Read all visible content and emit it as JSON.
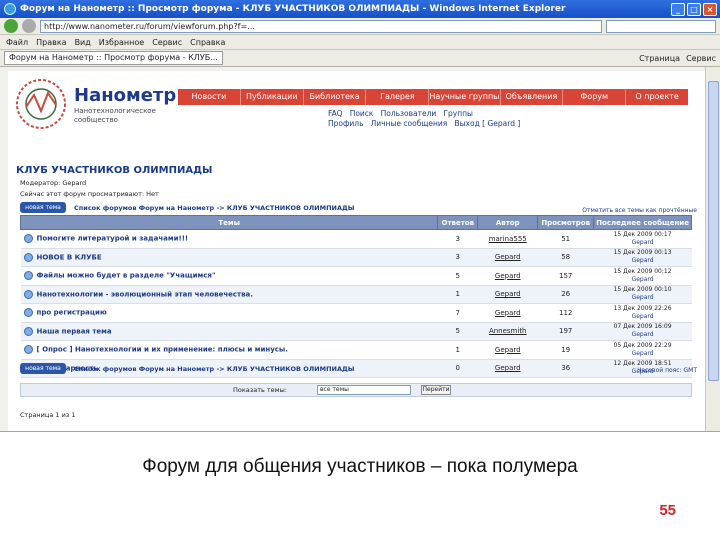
{
  "browser": {
    "window_title": "Форум на Нанометр :: Просмотр форума - КЛУБ УЧАСТНИКОВ ОЛИМПИАДЫ - Windows Internet Explorer",
    "window_buttons": [
      "_",
      "□",
      "×"
    ],
    "address": "http://www.nanometer.ru/forum/viewforum.php?f=...",
    "menu_items": [
      "Файл",
      "Правка",
      "Вид",
      "Избранное",
      "Сервис",
      "Справка"
    ],
    "tab_label": "Форум на Нанометр :: Просмотр форума - КЛУБ...",
    "toolbar_items": [
      "Страница",
      "Сервис"
    ]
  },
  "site": {
    "logo_text": "Нанометр",
    "logo_sub": "Нанотехнологическое сообщество",
    "nav": [
      "Новости",
      "Публикации",
      "Библиотека",
      "Галерея",
      "Научные группы",
      "Объявления",
      "Форум",
      "О проекте"
    ],
    "user_links_row1": [
      "FAQ",
      "Поиск",
      "Пользователи",
      "Группы"
    ],
    "user_links_row2": [
      "Профиль",
      "Личные сообщения",
      "Выход [ Gepard ]"
    ]
  },
  "forum": {
    "title": "КЛУБ УЧАСТНИКОВ ОЛИМПИАДЫ",
    "moderator": "Модератор: Gepard",
    "viewing": "Сейчас этот форум просматривают: Нет",
    "new_topic": "новая тема",
    "breadcrumb": "Список форумов Форум на Нанометр -> КЛУБ УЧАСТНИКОВ ОЛИМПИАДЫ",
    "mark_read": "Отметить все темы как прочтённые",
    "columns": [
      "Темы",
      "Ответов",
      "Автор",
      "Просмотров",
      "Последнее сообщение"
    ],
    "topics": [
      {
        "title": "Помогите литературой и задачами!!!",
        "replies": "3",
        "author": "marina555",
        "views": "51",
        "last_date": "15 Дек 2009 00:17",
        "last_by": "Gepard"
      },
      {
        "title": "НОВОЕ В КЛУБЕ",
        "replies": "3",
        "author": "Gepard",
        "views": "58",
        "last_date": "15 Дек 2009 00:13",
        "last_by": "Gepard"
      },
      {
        "title": "Файлы можно будет в разделе \"Учащимся\"",
        "replies": "5",
        "author": "Gepard",
        "views": "157",
        "last_date": "15 Дек 2009 00:12",
        "last_by": "Gepard"
      },
      {
        "title": "Нанотехнологии - эволюционный этап человечества.",
        "replies": "1",
        "author": "Gepard",
        "views": "26",
        "last_date": "15 Дек 2009 00:10",
        "last_by": "Gepard"
      },
      {
        "title": "про регистрацию",
        "replies": "7",
        "author": "Gepard",
        "views": "112",
        "last_date": "13 Дек 2009 22:26",
        "last_by": "Gepard"
      },
      {
        "title": "Наша первая тема",
        "replies": "5",
        "author": "Annesmith",
        "views": "197",
        "last_date": "07 Дек 2009 16:09",
        "last_by": "Gepard"
      },
      {
        "title": "[ Опрос ] Нанотехнологии и их применение: плюсы и минусы.",
        "replies": "1",
        "author": "Gepard",
        "views": "19",
        "last_date": "05 Дек 2009 22:29",
        "last_by": "Gepard"
      },
      {
        "title": "Благодарность",
        "replies": "0",
        "author": "Gepard",
        "views": "36",
        "last_date": "12 Дек 2009 18:51",
        "last_by": "Gepard"
      }
    ],
    "jump_label": "Показать темы:",
    "jump_select": "все темы",
    "go_button": "Перейти",
    "time_label": "Часовой пояс: GMT",
    "page_label": "Страница 1 из 1"
  },
  "slide": {
    "caption": "Форум для общения участников – пока полумера",
    "number": "55"
  }
}
